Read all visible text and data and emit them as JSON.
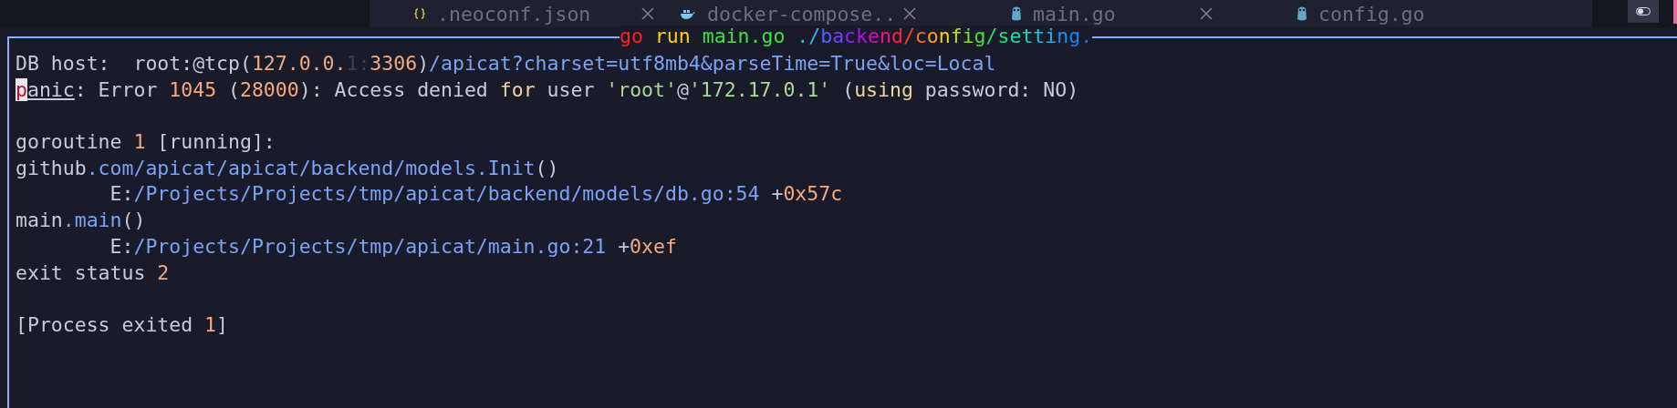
{
  "tabs": [
    {
      "label": ".neoconf.json",
      "kind": "braces",
      "closable": true
    },
    {
      "label": "docker-compose..",
      "kind": "whale",
      "closable": true
    },
    {
      "label": "main.go",
      "kind": "gopher",
      "closable": true
    },
    {
      "label": "config.go",
      "kind": "gopher",
      "closable": false
    }
  ],
  "terminal": {
    "title": "go run main.go ./backend/config/setting.",
    "lines": [
      {
        "kind": "text",
        "segments": [
          {
            "text": "DB host:  root:@tcp(",
            "kind": "plain"
          },
          {
            "text": "127.0.0.",
            "kind": "number"
          },
          {
            "text": "1:",
            "kind": "dim"
          },
          {
            "text": "3306",
            "kind": "number"
          },
          {
            "text": ")",
            "kind": "plain"
          },
          {
            "text": "/apicat?charset=utf8mb4&parseTime=True&loc=Local",
            "kind": "path"
          }
        ]
      },
      {
        "kind": "text",
        "segments": [
          {
            "text": "p",
            "kind": "cursor"
          },
          {
            "text": "anic",
            "kind": "underline"
          },
          {
            "text": ": Error ",
            "kind": "plain"
          },
          {
            "text": "1045",
            "kind": "number"
          },
          {
            "text": " (",
            "kind": "plain"
          },
          {
            "text": "28000",
            "kind": "number"
          },
          {
            "text": "): Access denied ",
            "kind": "plain"
          },
          {
            "text": "for",
            "kind": "keyword"
          },
          {
            "text": " user ",
            "kind": "plain"
          },
          {
            "text": "'root'",
            "kind": "string"
          },
          {
            "text": "@",
            "kind": "plain"
          },
          {
            "text": "'172.17.0.1'",
            "kind": "string"
          },
          {
            "text": " (",
            "kind": "plain"
          },
          {
            "text": "using",
            "kind": "keyword"
          },
          {
            "text": " password: NO)",
            "kind": "plain"
          }
        ]
      },
      {
        "kind": "blank"
      },
      {
        "kind": "text",
        "segments": [
          {
            "text": "goroutine ",
            "kind": "plain"
          },
          {
            "text": "1",
            "kind": "number"
          },
          {
            "text": " [running]:",
            "kind": "plain"
          }
        ]
      },
      {
        "kind": "text",
        "segments": [
          {
            "text": "github",
            "kind": "plain"
          },
          {
            "text": ".com/apicat/apicat/backend/models.Init",
            "kind": "path"
          },
          {
            "text": "()",
            "kind": "plain"
          }
        ]
      },
      {
        "kind": "text",
        "segments": [
          {
            "text": "        E:",
            "kind": "plain"
          },
          {
            "text": "/Projects/Projects/tmp/apicat/backend/models/db.go:54",
            "kind": "path"
          },
          {
            "text": " +",
            "kind": "plain"
          },
          {
            "text": "0x57c",
            "kind": "number"
          }
        ]
      },
      {
        "kind": "text",
        "segments": [
          {
            "text": "main",
            "kind": "plain"
          },
          {
            "text": ".main",
            "kind": "path"
          },
          {
            "text": "()",
            "kind": "plain"
          }
        ]
      },
      {
        "kind": "text",
        "segments": [
          {
            "text": "        E:",
            "kind": "plain"
          },
          {
            "text": "/Projects/Projects/tmp/apicat/main.go:21",
            "kind": "path"
          },
          {
            "text": " +",
            "kind": "plain"
          },
          {
            "text": "0xef",
            "kind": "number"
          }
        ]
      },
      {
        "kind": "text",
        "segments": [
          {
            "text": "exit status ",
            "kind": "plain"
          },
          {
            "text": "2",
            "kind": "number"
          }
        ]
      },
      {
        "kind": "blank"
      },
      {
        "kind": "text",
        "segments": [
          {
            "text": "[Process exited ",
            "kind": "plain"
          },
          {
            "text": "1",
            "kind": "number"
          },
          {
            "text": "]",
            "kind": "plain"
          }
        ]
      }
    ]
  }
}
